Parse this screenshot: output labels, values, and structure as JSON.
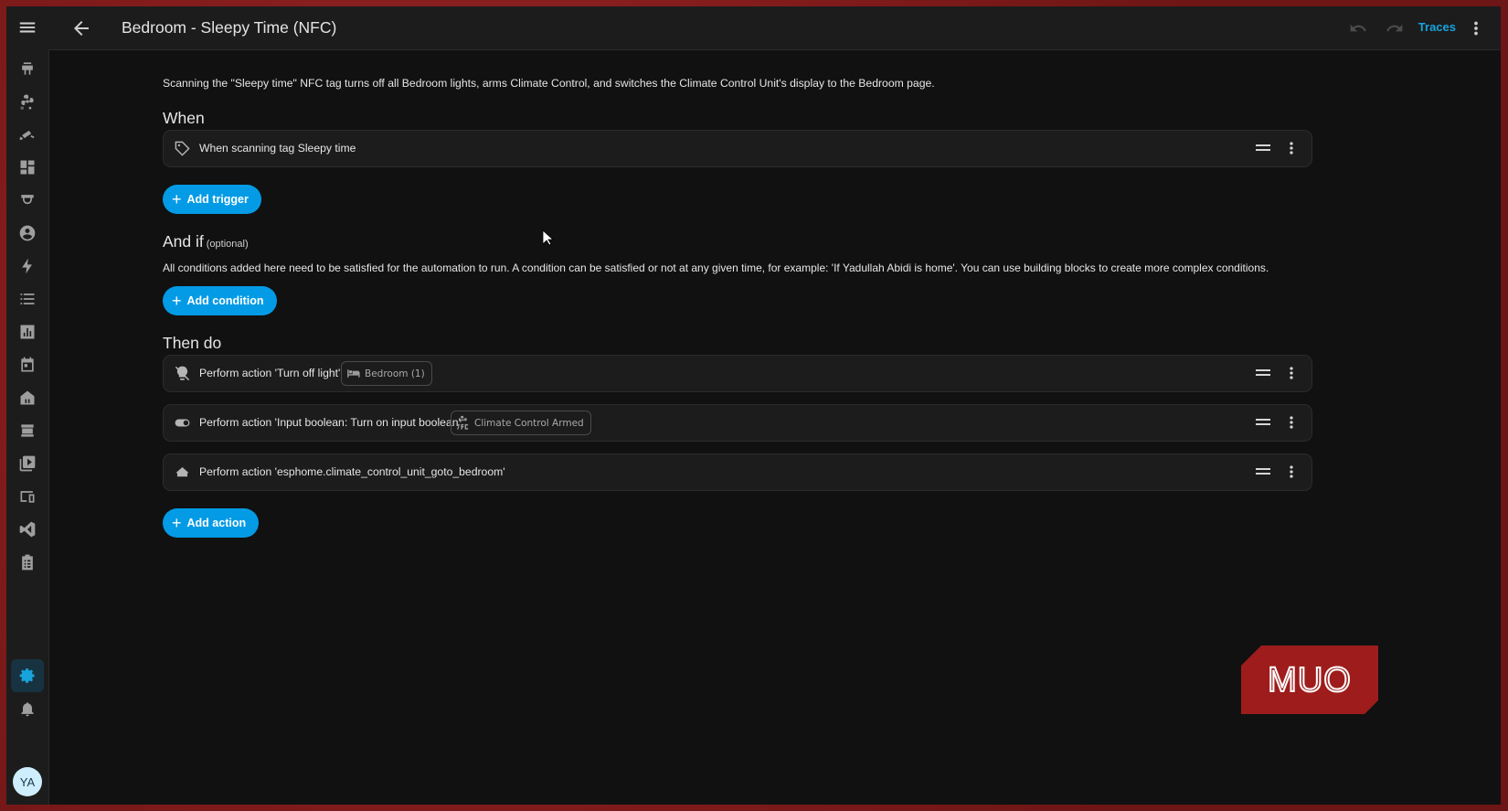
{
  "header": {
    "title": "Bedroom - Sleepy Time (NFC)",
    "traces_label": "Traces"
  },
  "description": "Scanning the \"Sleepy time\" NFC tag turns off all Bedroom lights, arms Climate Control, and switches the Climate Control Unit's display to the Bedroom page.",
  "triggers": {
    "title": "When",
    "items": [
      {
        "label": "When scanning tag Sleepy time",
        "icon": "tag-icon"
      }
    ],
    "add_label": "Add trigger"
  },
  "conditions": {
    "title": "And if",
    "optional_label": "(optional)",
    "description": "All conditions added here need to be satisfied for the automation to run. A condition can be satisfied or not at any given time, for example: 'If Yadullah Abidi is home'. You can use building blocks to create more complex conditions.",
    "add_label": "Add condition"
  },
  "actions": {
    "title": "Then do",
    "items": [
      {
        "label": "Perform action 'Turn off light'",
        "icon": "lightbulb-off-icon",
        "chip": "Bedroom (1)",
        "chip_icon": "bed-icon"
      },
      {
        "label": "Perform action 'Input boolean: Turn on input boolean'",
        "icon": "toggle-icon",
        "chip": "Climate Control Armed",
        "chip_icon": "air-conditioner-icon"
      },
      {
        "label": "Perform action 'esphome.climate_control_unit_goto_bedroom'",
        "icon": "esphome-icon"
      }
    ],
    "add_label": "Add action"
  },
  "user": {
    "initials": "YA"
  },
  "watermark": "MUO",
  "colors": {
    "accent": "#18a3dc",
    "button": "#039be5",
    "background": "#111111",
    "card": "#1c1c1c"
  }
}
